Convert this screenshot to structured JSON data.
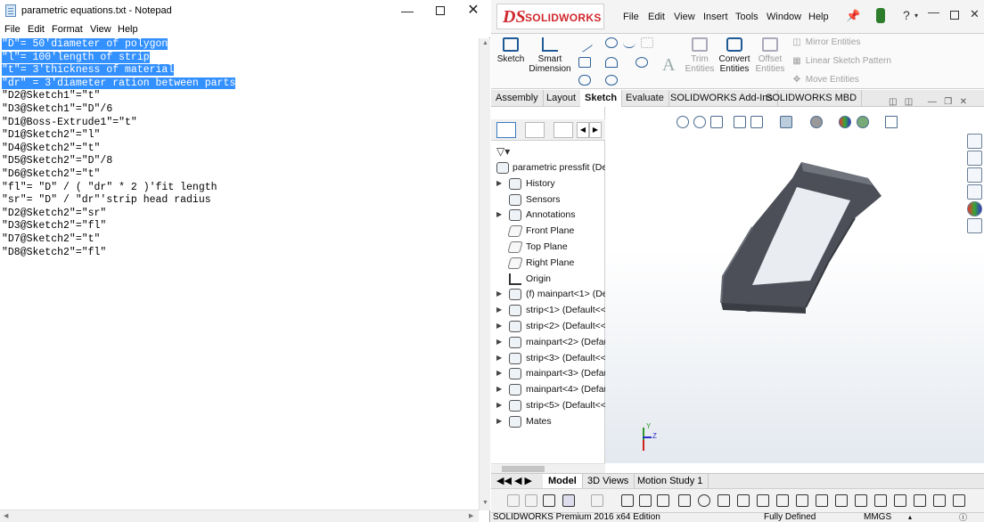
{
  "notepad": {
    "title": "parametric equations.txt - Notepad",
    "menu": [
      "File",
      "Edit",
      "Format",
      "View",
      "Help"
    ],
    "lines": [
      "\"D\"= 50'diameter of polygon",
      "\"l\"= 100'length of strip",
      "\"t\"= 3'thickness of material",
      "\"dr\" = 3'diameter ration between parts",
      "\"D2@Sketch1\"=\"t\"",
      "\"D3@Sketch1\"=\"D\"/6",
      "\"D1@Boss-Extrude1\"=\"t\"",
      "\"D1@Sketch2\"=\"l\"",
      "\"D4@Sketch2\"=\"t\"",
      "\"D5@Sketch2\"=\"D\"/8",
      "\"D6@Sketch2\"=\"t\"",
      "\"fl\"= \"D\" / ( \"dr\" * 2 )'fit length",
      "\"sr\"= \"D\" / \"dr\"'strip head radius",
      "\"D2@Sketch2\"=\"sr\"",
      "\"D3@Sketch2\"=\"fl\"",
      "\"D7@Sketch2\"=\"t\"",
      "\"D8@Sketch2\"=\"fl\""
    ],
    "selected_line_count": 4
  },
  "solidworks": {
    "logo": "SOLIDWORKS",
    "menu": [
      "File",
      "Edit",
      "View",
      "Insert",
      "Tools",
      "Window",
      "Help"
    ],
    "commands": {
      "sketch": "Sketch",
      "smart_dimension_1": "Smart",
      "smart_dimension_2": "Dimension",
      "trim_1": "Trim",
      "trim_2": "Entities",
      "convert_1": "Convert",
      "convert_2": "Entities",
      "offset_1": "Offset",
      "offset_2": "Entities",
      "mirror": "Mirror Entities",
      "linear_pattern": "Linear Sketch Pattern",
      "move": "Move Entities"
    },
    "tabs": [
      "Assembly",
      "Layout",
      "Sketch",
      "Evaluate",
      "SOLIDWORKS Add-Ins",
      "SOLIDWORKS MBD"
    ],
    "active_tab": "Sketch",
    "tree": [
      {
        "label": "parametric pressfit  (Defa",
        "icon": "assembly-icon",
        "expand": false,
        "type": "root"
      },
      {
        "label": "History",
        "icon": "history-icon",
        "expand": true,
        "type": "folder"
      },
      {
        "label": "Sensors",
        "icon": "sensors-icon",
        "expand": false,
        "type": "folder"
      },
      {
        "label": "Annotations",
        "icon": "annotations-icon",
        "expand": true,
        "type": "folder"
      },
      {
        "label": "Front Plane",
        "icon": "plane-icon",
        "expand": false,
        "type": "plane"
      },
      {
        "label": "Top Plane",
        "icon": "plane-icon",
        "expand": false,
        "type": "plane"
      },
      {
        "label": "Right Plane",
        "icon": "plane-icon",
        "expand": false,
        "type": "plane"
      },
      {
        "label": "Origin",
        "icon": "origin-icon",
        "expand": false,
        "type": "origin"
      },
      {
        "label": "(f) mainpart<1> (De",
        "icon": "part-icon",
        "expand": true,
        "type": "part"
      },
      {
        "label": "strip<1> (Default<<",
        "icon": "part-icon",
        "expand": true,
        "type": "part"
      },
      {
        "label": "strip<2> (Default<<",
        "icon": "part-icon",
        "expand": true,
        "type": "part"
      },
      {
        "label": "mainpart<2> (Defau",
        "icon": "part-icon",
        "expand": true,
        "type": "part"
      },
      {
        "label": "strip<3> (Default<<",
        "icon": "part-icon",
        "expand": true,
        "type": "part"
      },
      {
        "label": "mainpart<3> (Defau",
        "icon": "part-icon",
        "expand": true,
        "type": "part"
      },
      {
        "label": "mainpart<4> (Defau",
        "icon": "part-icon",
        "expand": true,
        "type": "part"
      },
      {
        "label": "strip<5> (Default<<",
        "icon": "part-icon",
        "expand": true,
        "type": "part"
      },
      {
        "label": "Mates",
        "icon": "mates-icon",
        "expand": true,
        "type": "folder"
      }
    ],
    "bottom_tabs": [
      "Model",
      "3D Views",
      "Motion Study 1"
    ],
    "active_bottom_tab": "Model",
    "triad": {
      "y": "Y",
      "z": "Z"
    },
    "status": {
      "edition": "SOLIDWORKS Premium 2016 x64 Edition",
      "state": "Fully Defined",
      "units": "MMGS"
    }
  }
}
